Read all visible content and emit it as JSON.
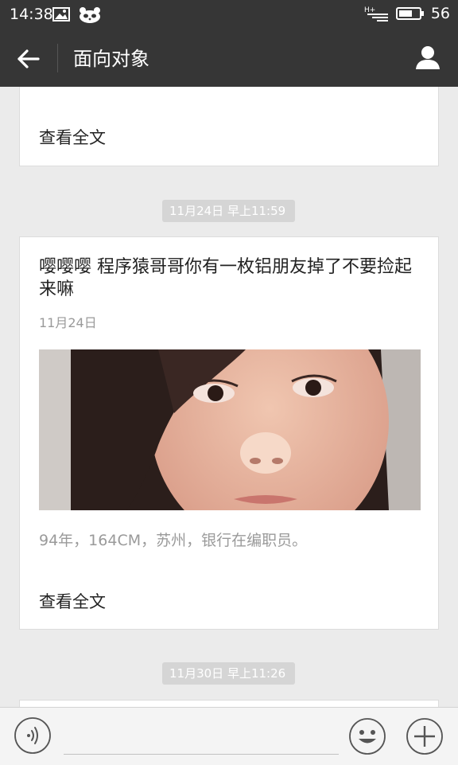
{
  "status_bar": {
    "time": "14:38",
    "battery": "56",
    "network": "H+"
  },
  "header": {
    "title": "面向对象",
    "back_icon": "back-arrow-icon",
    "profile_icon": "person-icon"
  },
  "messages": [
    {
      "read_full_label": "查看全文"
    },
    {
      "timestamp": "11月24日 早上11:59",
      "title": "嘤嘤嘤 程序猿哥哥你有一枚铝朋友掉了不要捡起来嘛",
      "date": "11月24日",
      "summary": "94年，164CM，苏州，银行在编职员。",
      "read_full_label": "查看全文"
    },
    {
      "timestamp": "11月30日 早上11:26"
    }
  ],
  "input_bar": {
    "voice_icon": "voice-icon",
    "emoji_icon": "emoji-icon",
    "plus_icon": "plus-icon"
  },
  "colors": {
    "header_bg": "#363636",
    "page_bg": "#ebebeb",
    "pill_bg": "#d5d5d5",
    "muted_text": "#9a9a9a"
  }
}
